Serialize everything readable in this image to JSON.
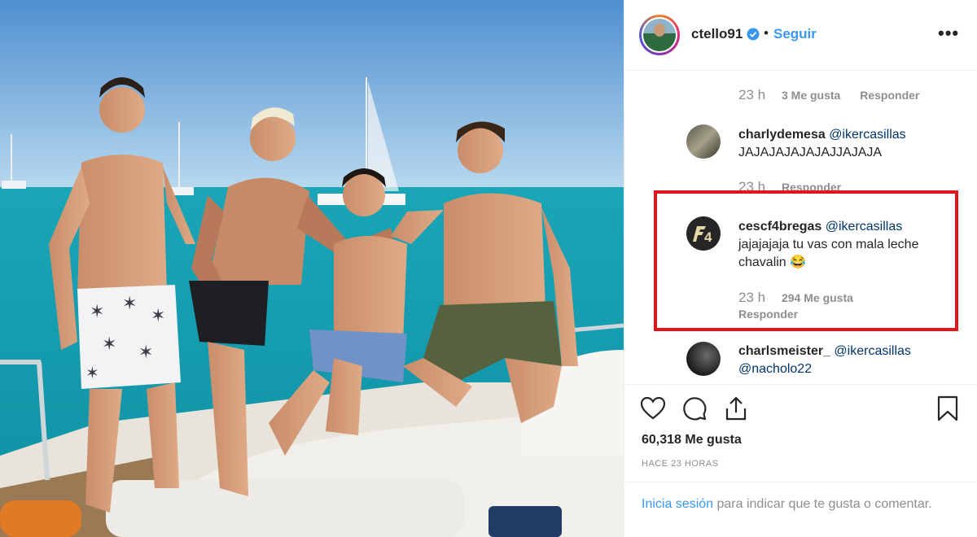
{
  "header": {
    "username": "ctello91",
    "separator": "•",
    "follow_label": "Seguir",
    "more_label": "•••"
  },
  "comments": [
    {
      "user": "",
      "text": "",
      "time": "23 h",
      "likes": "3 Me gusta",
      "reply": "Responder"
    },
    {
      "user": "charlydemesa",
      "mention": "@ikercasillas",
      "text": "JAJAJAJAJAJAJJAJAJA",
      "time": "23 h",
      "reply": "Responder"
    },
    {
      "user": "cescf4bregas",
      "mention": "@ikercasillas",
      "text": "jajajajaja tu vas con mala leche chavalin 😂",
      "time": "23 h",
      "likes": "294 Me gusta",
      "reply": "Responder"
    },
    {
      "user": "charlsmeister_",
      "mention": "@ikercasillas",
      "mention2": "@nacholo22"
    }
  ],
  "avatar_badge": "4",
  "actions": {
    "like_icon": "heart-icon",
    "comment_icon": "comment-icon",
    "share_icon": "share-icon",
    "save_icon": "bookmark-icon"
  },
  "likes_count": "60,318 Me gusta",
  "timestamp": "HACE 23 HORAS",
  "login": {
    "link": "Inicia sesión",
    "text": " para indicar que te gusta o comentar."
  },
  "colors": {
    "link_blue": "#3897f0",
    "mention_blue": "#003569",
    "highlight_red": "#e3141b",
    "muted_gray": "#8e8e8e"
  }
}
